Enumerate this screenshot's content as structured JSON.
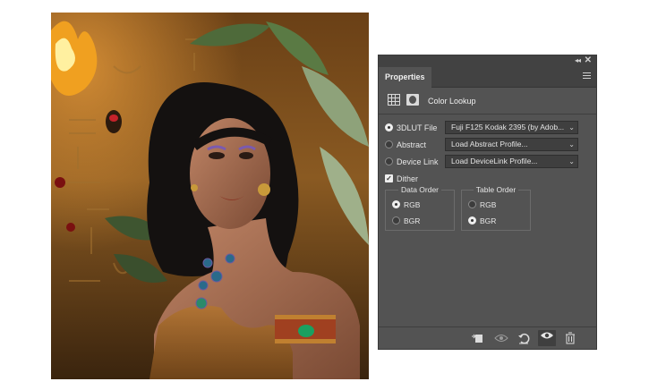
{
  "panel": {
    "tab": "Properties",
    "adjustment_title": "Color Lookup",
    "rows": [
      {
        "label": "3DLUT File",
        "selected": true,
        "value": "Fuji F125 Kodak 2395 (by Adob..."
      },
      {
        "label": "Abstract",
        "selected": false,
        "value": "Load Abstract Profile..."
      },
      {
        "label": "Device Link",
        "selected": false,
        "value": "Load DeviceLink Profile..."
      }
    ],
    "dither": {
      "label": "Dither",
      "checked": true
    },
    "data_order": {
      "title": "Data Order",
      "options": [
        "RGB",
        "BGR"
      ],
      "selected": "RGB"
    },
    "table_order": {
      "title": "Table Order",
      "options": [
        "RGB",
        "BGR"
      ],
      "selected": "BGR"
    },
    "window_controls": {
      "collapse": "◂◂",
      "close": "✕"
    },
    "bottom_icons": [
      "clip-to-layer-icon",
      "view-previous-state-icon",
      "reset-icon",
      "visibility-eye-icon",
      "trash-icon"
    ]
  },
  "colors": {
    "panel_bg": "#535353",
    "panel_header": "#424242",
    "field_bg": "#3f3f3f",
    "text": "#e6e6e6"
  }
}
